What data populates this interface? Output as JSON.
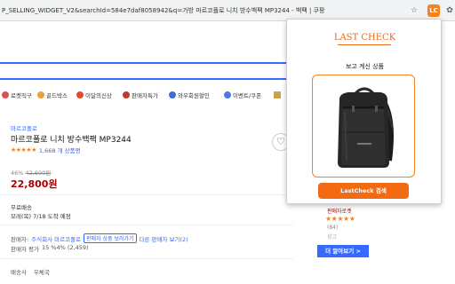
{
  "browser": {
    "url": "P_SELLING_WIDGET_V2&searchId=584e7daf8058942&q=가방 마르코폴로 니치 방수백팩 MP3244 - 백팩 | 쿠팡",
    "star_icon": "☆",
    "puzzle_icon": "✿",
    "ext_icon_label": "LC"
  },
  "categories": [
    {
      "label": "로켓직구",
      "color": "#d9534f"
    },
    {
      "label": "골드박스",
      "color": "#e8a33a"
    },
    {
      "label": "이달의신상",
      "color": "#e04b2c"
    },
    {
      "label": "판매자특가",
      "color": "#c0392b"
    },
    {
      "label": "와우회원할인",
      "color": "#3b6fd8"
    },
    {
      "label": "이벤트/쿠폰",
      "color": "#4a7be0"
    },
    {
      "label": "",
      "color": "#c9a24a"
    }
  ],
  "product": {
    "brand": "마르코폴로",
    "title": "마르코폴로 니치 방수백팩 MP3244",
    "stars": "★★★★★",
    "reviews": "1,668 개 상품평",
    "discount": "46%",
    "original_price": "42,600원",
    "sale_price": "22,800원",
    "delivery_label": "무료배송",
    "delivery_info": "모레(목) 7/18 도착 예정",
    "seller_label": "판매자:",
    "seller_name": "주식회사 마르코폴로",
    "seller_button": "판매자 상품 보러가기",
    "other_sellers": "다른 판매자 보기(2)",
    "seller_rating": "판매자 평가",
    "seller_rating_value": "15 %4% (2,459)",
    "shipping_label": "배송사",
    "shipping_company": "우체국",
    "heart_icon": "♡",
    "share_icon": "⋖"
  },
  "side_ad": {
    "label": "판매자로켓",
    "stars": "★★★★★",
    "count": "(84)",
    "tag": "광고",
    "more_button": "더 알아보기 >"
  },
  "popup": {
    "logo": "LAST CHECK",
    "heading": "보고 계신 상품",
    "button": "LastCheck 검색"
  }
}
